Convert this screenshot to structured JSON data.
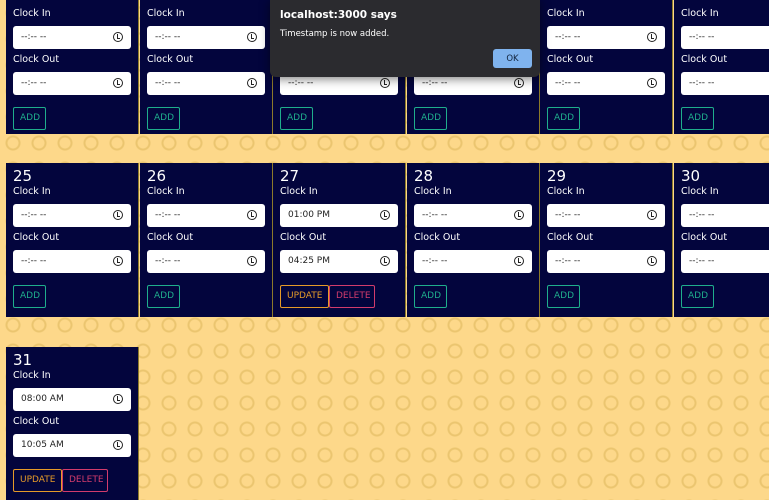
{
  "labels": {
    "clock_in": "Clock In",
    "clock_out": "Clock Out"
  },
  "buttons": {
    "add": "ADD",
    "update": "UPDATE",
    "delete": "DELETE"
  },
  "empty_time": "--:-- --",
  "rows": [
    [
      {
        "day": "",
        "in": "--:-- --",
        "out": "--:-- --",
        "has_entry": false
      },
      {
        "day": "",
        "in": "--:-- --",
        "out": "--:-- --",
        "has_entry": false
      },
      {
        "day": "",
        "in": "--:-- --",
        "out": "--:-- --",
        "has_entry": false
      },
      {
        "day": "",
        "in": "--:-- --",
        "out": "--:-- --",
        "has_entry": false
      },
      {
        "day": "",
        "in": "--:-- --",
        "out": "--:-- --",
        "has_entry": false
      },
      {
        "day": "",
        "in": "--:-- --",
        "out": "--:-- --",
        "has_entry": false
      }
    ],
    [
      {
        "day": "25",
        "in": "--:-- --",
        "out": "--:-- --",
        "has_entry": false
      },
      {
        "day": "26",
        "in": "--:-- --",
        "out": "--:-- --",
        "has_entry": false
      },
      {
        "day": "27",
        "in": "01:00 PM",
        "out": "04:25 PM",
        "has_entry": true
      },
      {
        "day": "28",
        "in": "--:-- --",
        "out": "--:-- --",
        "has_entry": false
      },
      {
        "day": "29",
        "in": "--:-- --",
        "out": "--:-- --",
        "has_entry": false
      },
      {
        "day": "30",
        "in": "--:-- --",
        "out": "--:-- --",
        "has_entry": false
      }
    ],
    [
      {
        "day": "31",
        "in": "08:00 AM",
        "out": "10:05 AM",
        "has_entry": true
      }
    ]
  ],
  "dialog": {
    "title": "localhost:3000 says",
    "message": "Timestamp is now added.",
    "ok_label": "OK"
  }
}
